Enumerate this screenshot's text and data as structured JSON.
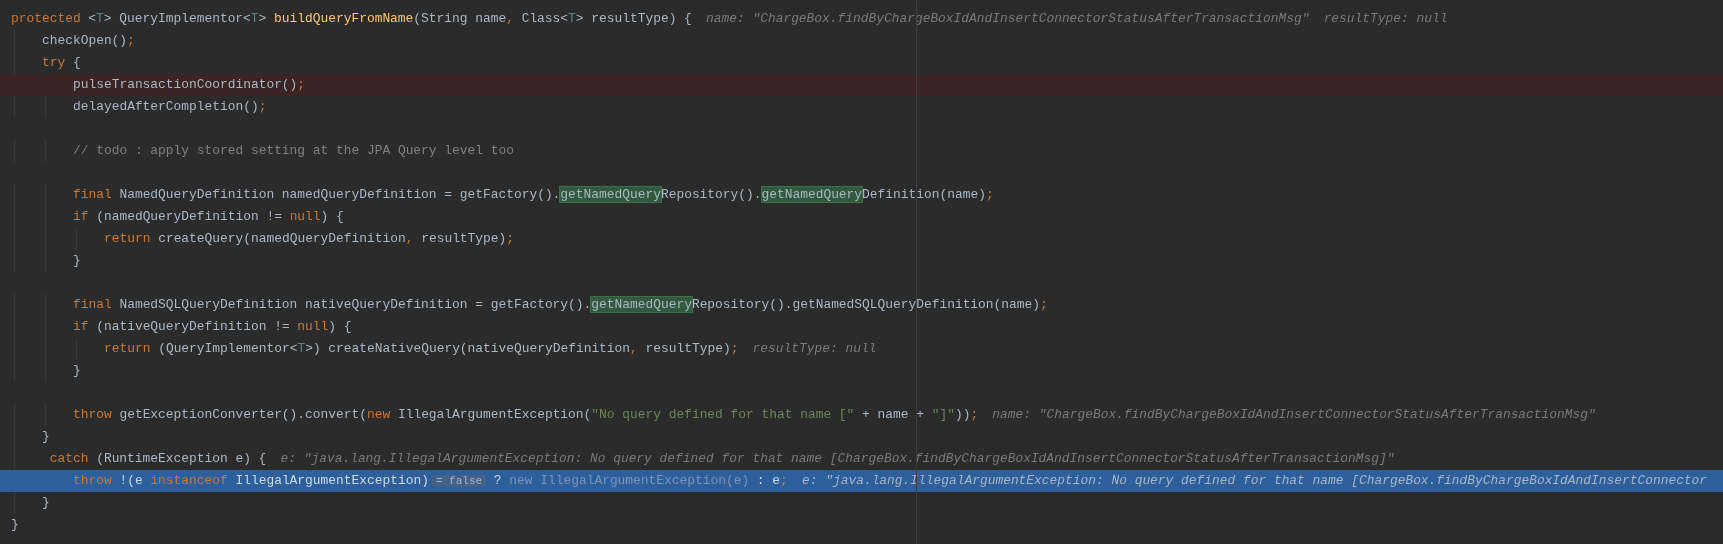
{
  "lines": [
    {
      "kind": "code",
      "tokens": [
        {
          "kind": "keyword",
          "text": "protected"
        },
        {
          "kind": "text",
          "text": " <"
        },
        {
          "kind": "type",
          "text": "T"
        },
        {
          "kind": "text",
          "text": "> QueryImplementor<"
        },
        {
          "kind": "type",
          "text": "T"
        },
        {
          "kind": "text",
          "text": "> "
        },
        {
          "kind": "method",
          "text": "buildQueryFromName"
        },
        {
          "kind": "text",
          "text": "(String name"
        },
        {
          "kind": "punct",
          "text": ","
        },
        {
          "kind": "text",
          "text": " Class<"
        },
        {
          "kind": "type",
          "text": "T"
        },
        {
          "kind": "text",
          "text": "> resultType) {"
        },
        {
          "kind": "hint",
          "text": "name: \"ChargeBox.findByChargeBoxIdAndInsertConnectorStatusAfterTransactionMsg\""
        },
        {
          "kind": "hint",
          "text": "resultType: null"
        }
      ],
      "children": [
        {
          "kind": "code",
          "tokens": [
            {
              "kind": "text",
              "text": "checkOpen()"
            },
            {
              "kind": "punct",
              "text": ";"
            }
          ]
        },
        {
          "kind": "code",
          "tokens": [
            {
              "kind": "keyword",
              "text": "try"
            },
            {
              "kind": "text",
              "text": " {"
            }
          ],
          "children": [
            {
              "kind": "breakpoint",
              "tokens": [
                {
                  "kind": "text",
                  "text": "pulseTransactionCoordinator()"
                },
                {
                  "kind": "punct",
                  "text": ";"
                }
              ]
            },
            {
              "kind": "code",
              "tokens": [
                {
                  "kind": "text",
                  "text": "delayedAfterCompletion()"
                },
                {
                  "kind": "punct",
                  "text": ";"
                }
              ]
            },
            {
              "kind": "blank"
            },
            {
              "kind": "code",
              "tokens": [
                {
                  "kind": "comment",
                  "text": "// todo : apply stored setting at the JPA Query level too"
                }
              ]
            },
            {
              "kind": "blank"
            },
            {
              "kind": "code",
              "tokens": [
                {
                  "kind": "keyword",
                  "text": "final"
                },
                {
                  "kind": "text",
                  "text": " NamedQueryDefinition namedQueryDefinition = getFactory()."
                },
                {
                  "kind": "match",
                  "text": "getNamedQuery"
                },
                {
                  "kind": "text",
                  "text": "Repository()."
                },
                {
                  "kind": "match",
                  "text": "getNamedQuery"
                },
                {
                  "kind": "text",
                  "text": "Definition(name)"
                },
                {
                  "kind": "punct",
                  "text": ";"
                }
              ]
            },
            {
              "kind": "code",
              "tokens": [
                {
                  "kind": "keyword",
                  "text": "if"
                },
                {
                  "kind": "text",
                  "text": " (namedQueryDefinition != "
                },
                {
                  "kind": "keyword",
                  "text": "null"
                },
                {
                  "kind": "text",
                  "text": ") {"
                }
              ],
              "children": [
                {
                  "kind": "code",
                  "tokens": [
                    {
                      "kind": "keyword",
                      "text": "return"
                    },
                    {
                      "kind": "text",
                      "text": " createQuery(namedQueryDefinition"
                    },
                    {
                      "kind": "punct",
                      "text": ","
                    },
                    {
                      "kind": "text",
                      "text": " resultType)"
                    },
                    {
                      "kind": "punct",
                      "text": ";"
                    }
                  ]
                }
              ]
            },
            {
              "kind": "code",
              "tokens": [
                {
                  "kind": "text",
                  "text": "}"
                }
              ]
            },
            {
              "kind": "blank"
            },
            {
              "kind": "code",
              "tokens": [
                {
                  "kind": "keyword",
                  "text": "final"
                },
                {
                  "kind": "text",
                  "text": " NamedSQLQueryDefinition nativeQueryDefinition = getFactory()."
                },
                {
                  "kind": "match",
                  "text": "getNamedQuery"
                },
                {
                  "kind": "text",
                  "text": "Repository().getNamedSQLQueryDefinition(name)"
                },
                {
                  "kind": "punct",
                  "text": ";"
                }
              ]
            },
            {
              "kind": "code",
              "tokens": [
                {
                  "kind": "keyword",
                  "text": "if"
                },
                {
                  "kind": "text",
                  "text": " (nativeQueryDefinition != "
                },
                {
                  "kind": "keyword",
                  "text": "null"
                },
                {
                  "kind": "text",
                  "text": ") {"
                }
              ],
              "children": [
                {
                  "kind": "code",
                  "tokens": [
                    {
                      "kind": "keyword",
                      "text": "return"
                    },
                    {
                      "kind": "text",
                      "text": " (QueryImplementor<"
                    },
                    {
                      "kind": "type",
                      "text": "T"
                    },
                    {
                      "kind": "text",
                      "text": ">) createNativeQuery(nativeQueryDefinition"
                    },
                    {
                      "kind": "punct",
                      "text": ","
                    },
                    {
                      "kind": "text",
                      "text": " resultType)"
                    },
                    {
                      "kind": "punct",
                      "text": ";"
                    },
                    {
                      "kind": "hint",
                      "text": "resultType: null"
                    }
                  ]
                }
              ]
            },
            {
              "kind": "code",
              "tokens": [
                {
                  "kind": "text",
                  "text": "}"
                }
              ]
            },
            {
              "kind": "blank"
            },
            {
              "kind": "code",
              "tokens": [
                {
                  "kind": "keyword",
                  "text": "throw"
                },
                {
                  "kind": "text",
                  "text": " getExceptionConverter().convert("
                },
                {
                  "kind": "keyword",
                  "text": "new"
                },
                {
                  "kind": "text",
                  "text": " IllegalArgumentException("
                },
                {
                  "kind": "string",
                  "text": "\"No query defined for that name [\""
                },
                {
                  "kind": "text",
                  "text": " + name + "
                },
                {
                  "kind": "string",
                  "text": "\"]\""
                },
                {
                  "kind": "text",
                  "text": "))"
                },
                {
                  "kind": "punct",
                  "text": ";"
                },
                {
                  "kind": "hint",
                  "text": "name: \"ChargeBox.findByChargeBoxIdAndInsertConnectorStatusAfterTransactionMsg\""
                }
              ]
            }
          ]
        },
        {
          "kind": "code",
          "tokens": [
            {
              "kind": "text",
              "text": "}"
            }
          ]
        },
        {
          "kind": "code",
          "tokens": [
            {
              "kind": "keyword",
              "text": " catch"
            },
            {
              "kind": "text",
              "text": " (RuntimeException e) {"
            },
            {
              "kind": "hint",
              "text": "e: \"java.lang.IllegalArgumentException: No query defined for that name [ChargeBox.findByChargeBoxIdAndInsertConnectorStatusAfterTransactionMsg]\""
            }
          ],
          "children": [
            {
              "kind": "execution",
              "tokens": [
                {
                  "kind": "keyword",
                  "text": "throw"
                },
                {
                  "kind": "text",
                  "text": " !(e "
                },
                {
                  "kind": "keyword",
                  "text": "instanceof"
                },
                {
                  "kind": "text",
                  "text": " IllegalArgumentException)"
                },
                {
                  "kind": "badge",
                  "text": "= false"
                },
                {
                  "kind": "text",
                  "text": " ? "
                },
                {
                  "kind": "dim",
                  "text": "new IllegalArgumentException(e)"
                },
                {
                  "kind": "text",
                  "text": " : e"
                },
                {
                  "kind": "punct",
                  "text": ";"
                },
                {
                  "kind": "hint",
                  "text": "e: \"java.lang.IllegalArgumentException: No query defined for that name [ChargeBox.findByChargeBoxIdAndInsertConnector"
                }
              ]
            }
          ]
        },
        {
          "kind": "code",
          "tokens": [
            {
              "kind": "text",
              "text": "}"
            }
          ]
        }
      ]
    },
    {
      "kind": "code",
      "tokens": [
        {
          "kind": "text",
          "text": "}"
        }
      ]
    }
  ]
}
